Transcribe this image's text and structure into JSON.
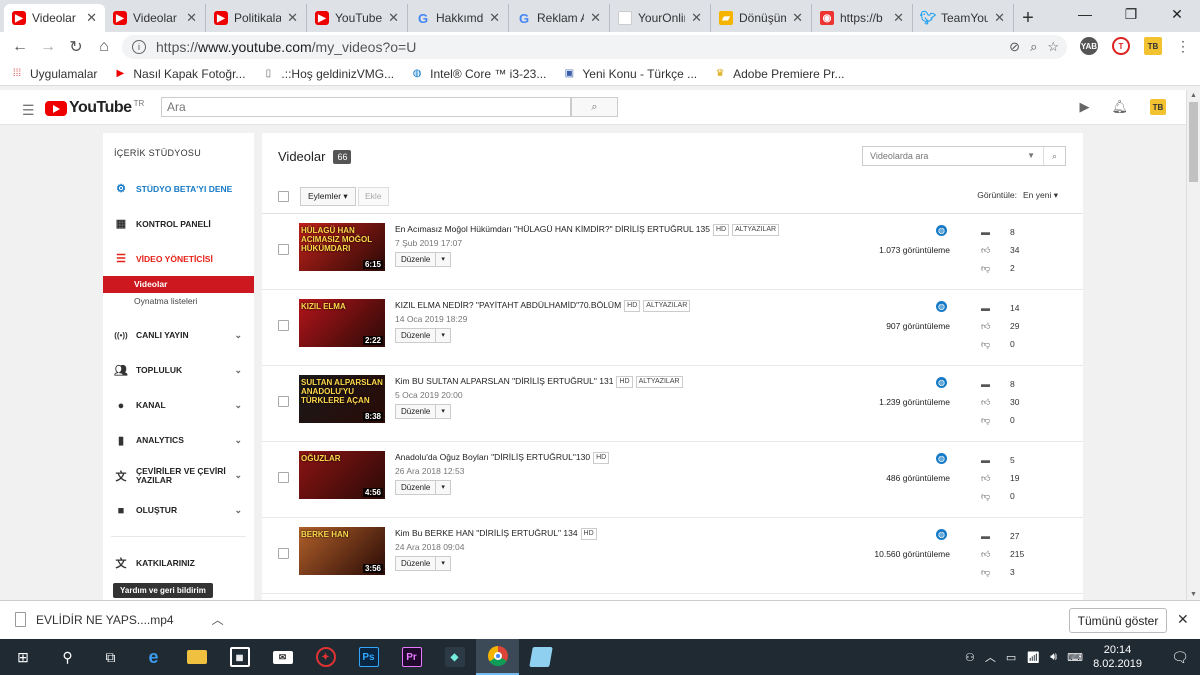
{
  "browser": {
    "tabs": [
      {
        "label": "Videolar",
        "icon": "youtube",
        "active": true
      },
      {
        "label": "Videolar",
        "icon": "youtube"
      },
      {
        "label": "Politikala",
        "icon": "youtube"
      },
      {
        "label": "YouTube",
        "icon": "youtube"
      },
      {
        "label": "Hakkımd",
        "icon": "google"
      },
      {
        "label": "Reklam A",
        "icon": "google"
      },
      {
        "label": "YourOnlin",
        "icon": "blank"
      },
      {
        "label": "Dönüşüm",
        "icon": "folder"
      },
      {
        "label": "https://b",
        "icon": "red"
      },
      {
        "label": "TeamYou",
        "icon": "twitter"
      }
    ],
    "url_prefix": "https://",
    "url_host": "www.youtube.com",
    "url_path": "/my_videos?o=U",
    "bookmarks": [
      {
        "label": "Uygulamalar",
        "icon": "apps-grid"
      },
      {
        "label": "Nasıl Kapak Fotoğr...",
        "icon": "youtube"
      },
      {
        "label": ".::Hoş geldinizVMG...",
        "icon": "page"
      },
      {
        "label": "Intel® Core ™ i3-23...",
        "icon": "intel"
      },
      {
        "label": "Yeni Konu - Türkçe ...",
        "icon": "forum"
      },
      {
        "label": "Adobe Premiere Pr...",
        "icon": "crown"
      }
    ]
  },
  "youtube": {
    "logo_text": "YouTube",
    "region": "TR",
    "search_placeholder": "Ara"
  },
  "sidebar": {
    "header": "İÇERİK STÜDYOSU",
    "items": [
      {
        "label": "STÜDYO BETA'YI DENE",
        "icon": "gear-icon",
        "style": "blue"
      },
      {
        "label": "KONTROL PANELİ",
        "icon": "dashboard-icon"
      },
      {
        "label": "VİDEO YÖNETİCİSİ",
        "icon": "video-manager-icon",
        "style": "red"
      }
    ],
    "subitems": [
      {
        "label": "Videolar",
        "selected": true
      },
      {
        "label": "Oynatma listeleri"
      }
    ],
    "groups": [
      {
        "label": "CANLI YAYIN",
        "icon": "live-icon"
      },
      {
        "label": "TOPLULUK",
        "icon": "community-icon"
      },
      {
        "label": "KANAL",
        "icon": "channel-icon"
      },
      {
        "label": "ANALYTICS",
        "icon": "analytics-icon"
      },
      {
        "label": "ÇEVİRİLER VE ÇEVİRİ YAZILAR",
        "icon": "translate-icon"
      },
      {
        "label": "OLUŞTUR",
        "icon": "create-icon"
      }
    ],
    "contributions": "KATKILARINIZ",
    "help_button": "Yardım ve geri bildirim"
  },
  "main": {
    "title": "Videolar",
    "count": "66",
    "search_placeholder": "Videolarda ara",
    "actions_label": "Eylemler",
    "add_label": "Ekle",
    "view_label": "Görüntüle:",
    "view_value": "En yeni",
    "edit_label": "Düzenle",
    "videos": [
      {
        "title": "En Acımasız Moğol Hükümdarı \"HÜLAGÜ HAN KİMDİR?\" DİRİLİŞ ERTUĞRUL 135",
        "badges": [
          "HD",
          "ALTYAZILAR"
        ],
        "date": "7 Şub 2019 17:07",
        "duration": "6:15",
        "views": "1.073 görüntüleme",
        "comments": "8",
        "likes": "34",
        "dislikes": "2",
        "thumb_text": "HÜLAGÜ HAN ACIMASIZ MOĞOL HÜKÜMDARI",
        "thumb_color": "#c0201a"
      },
      {
        "title": "KIZIL ELMA NEDİR? \"PAYİTAHT ABDÜLHAMİD\"70.BÖLÜM",
        "badges": [
          "HD",
          "ALTYAZILAR"
        ],
        "date": "14 Oca 2019 18:29",
        "duration": "2:22",
        "views": "907 görüntüleme",
        "comments": "14",
        "likes": "29",
        "dislikes": "0",
        "thumb_text": "KIZIL ELMA",
        "thumb_color": "#b3141a"
      },
      {
        "title": "Kim BU SULTAN ALPARSLAN \"DİRİLİŞ ERTUĞRUL\" 131",
        "badges": [
          "HD",
          "ALTYAZILAR"
        ],
        "date": "5 Oca 2019 20:00",
        "duration": "8:38",
        "views": "1.239 görüntüleme",
        "comments": "8",
        "likes": "30",
        "dislikes": "0",
        "thumb_text": "SULTAN ALPARSLAN ANADOLU'YU TÜRKLERE AÇAN",
        "thumb_color": "#1a1a1a"
      },
      {
        "title": "Anadolu'da Oğuz Boyları \"DİRİLİŞ ERTUĞRUL\"130",
        "badges": [
          "HD"
        ],
        "date": "26 Ara 2018 12:53",
        "duration": "4:56",
        "views": "486 görüntüleme",
        "comments": "5",
        "likes": "19",
        "dislikes": "0",
        "thumb_text": "OĞUZLAR",
        "thumb_color": "#8c1414"
      },
      {
        "title": "Kim Bu BERKE HAN \"DİRİLİŞ ERTUĞRUL\" 134",
        "badges": [
          "HD"
        ],
        "date": "24 Ara 2018 09:04",
        "duration": "3:56",
        "views": "10.560 görüntüleme",
        "comments": "27",
        "likes": "215",
        "dislikes": "3",
        "thumb_text": "BERKE HAN",
        "thumb_color": "#b0602a"
      }
    ]
  },
  "download": {
    "filename": "EVLİDİR NE YAPS....mp4",
    "show_all": "Tümünü göster"
  },
  "taskbar": {
    "time": "20:14",
    "date": "8.02.2019"
  }
}
